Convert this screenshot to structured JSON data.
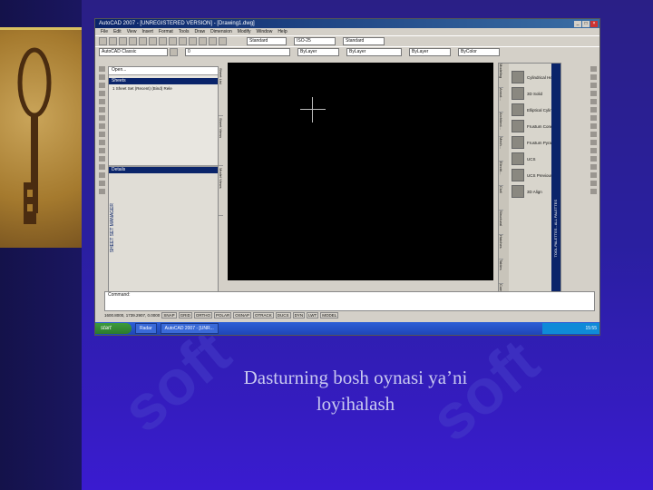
{
  "slide": {
    "caption_line1": "Dasturning bosh oynasi ya’ni",
    "caption_line2": "loyihalash",
    "watermark_text": "soft"
  },
  "app": {
    "title": "AutoCAD 2007 - [UNREGISTERED VERSION] - [Drawing1.dwg]",
    "menu": [
      "File",
      "Edit",
      "View",
      "Insert",
      "Format",
      "Tools",
      "Draw",
      "Dimension",
      "Modify",
      "Window",
      "Help"
    ],
    "workspace_combo": "AutoCAD Classic",
    "text_style": "Standard",
    "dim_style": "ISO-25",
    "table_style": "Standard",
    "layer": "0",
    "color": "ByLayer",
    "linetype": "ByLayer",
    "lineweight": "ByLayer",
    "plotstyle": "ByColor"
  },
  "sheet_set": {
    "open_combo": "Open...",
    "sheets_header": "Sheets",
    "recent_item": "1 Sheet Set (Recent) (Bind) Rele",
    "details_header": "Details",
    "vertical_title": "SHEET SET MANAGER",
    "tabs": [
      "Sheet List",
      "Sheet Views",
      "Model Views"
    ]
  },
  "tool_palette": {
    "items": [
      {
        "label": "Cylindrical Helix",
        "icon": "helix-icon"
      },
      {
        "label": "3D Solid",
        "icon": "solid-icon"
      },
      {
        "label": "Elliptical Cylinder",
        "icon": "cylinder-icon"
      },
      {
        "label": "Frustum Cone",
        "icon": "cone-icon"
      },
      {
        "label": "Frustum Pyramid",
        "icon": "pyramid-icon"
      },
      {
        "label": "UCS",
        "icon": "ucs-icon"
      },
      {
        "label": "UCS Previous",
        "icon": "ucs-previous-icon"
      },
      {
        "label": "3D Align",
        "icon": "align-icon"
      }
    ],
    "tabs": [
      "Modeling",
      "Annot...",
      "Architect...",
      "Mech...",
      "Electri...",
      "Civil",
      "Structural",
      "Hatches",
      "Tables",
      "Comm...",
      "Draw",
      "Modify"
    ],
    "vertical_title": "TOOL PALETTES - ALL PALETTES"
  },
  "command_line": "Command:",
  "status": {
    "coords": "1600.8000, 1739.2907, 0.0000",
    "buttons": [
      "SNAP",
      "GRID",
      "ORTHO",
      "POLAR",
      "OSNAP",
      "OTRACK",
      "DUCS",
      "DYN",
      "LWT",
      "MODEL"
    ]
  },
  "taskbar": {
    "start": "start",
    "tasks": [
      "Radar",
      "AutoCAD 2007 - [UNR..."
    ],
    "clock": "15:55"
  }
}
